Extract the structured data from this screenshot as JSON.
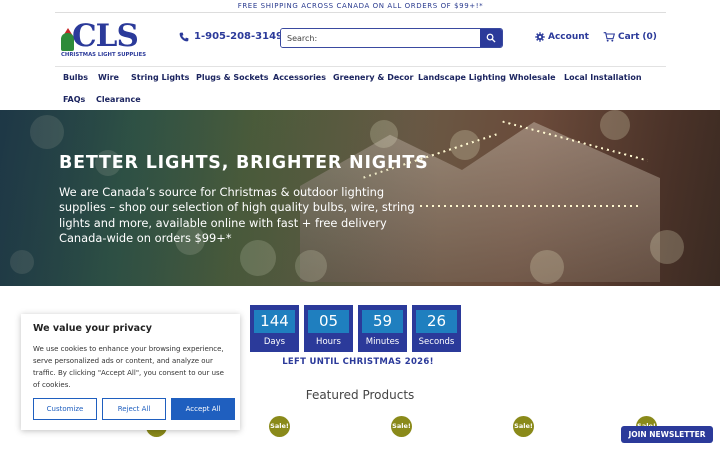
{
  "topbar": {
    "text": "FREE SHIPPING ACROSS CANADA ON ALL ORDERS OF $99+!*"
  },
  "logo": {
    "letters": "CLS",
    "subtitle": "CHRISTMAS LIGHT SUPPLIES"
  },
  "header": {
    "phone": "1-905-208-3149",
    "search_placeholder": "Search:",
    "account_label": "Account",
    "cart_label": "Cart",
    "cart_count": "(0)"
  },
  "nav": {
    "items": [
      "Bulbs",
      "Wire",
      "String Lights",
      "Plugs & Sockets",
      "Accessories",
      "Greenery & Decor",
      "Landscape Lighting",
      "Wholesale",
      "Local Installation",
      "FAQs",
      "Clearance"
    ]
  },
  "hero": {
    "title": "BETTER LIGHTS, BRIGHTER NIGHTS",
    "description": "We are Canada’s source for Christmas & outdoor lighting supplies – shop our selection of high quality bulbs, wire, string lights and more, available online with fast + free delivery Canada-wide on orders $99+*"
  },
  "countdown": {
    "units": [
      {
        "value": "144",
        "label": "Days"
      },
      {
        "value": "05",
        "label": "Hours"
      },
      {
        "value": "59",
        "label": "Minutes"
      },
      {
        "value": "26",
        "label": "Seconds"
      }
    ],
    "caption": "LEFT UNTIL CHRISTMAS 2026!"
  },
  "featured": {
    "heading": "Featured Products",
    "badge": "Sale!"
  },
  "privacy": {
    "title": "We value your privacy",
    "body": "We use cookies to enhance your browsing experience, serve personalized ads or content, and analyze our traffic. By clicking \"Accept All\", you consent to our use of cookies.",
    "customize": "Customize",
    "reject": "Reject All",
    "accept": "Accept All"
  },
  "newsletter": {
    "label": "JOIN NEWSLETTER"
  },
  "colors": {
    "brand": "#2b3a9a",
    "accent": "#1f7fbf",
    "sale": "#8a8a1a",
    "cookie_button": "#1f5fbf"
  }
}
